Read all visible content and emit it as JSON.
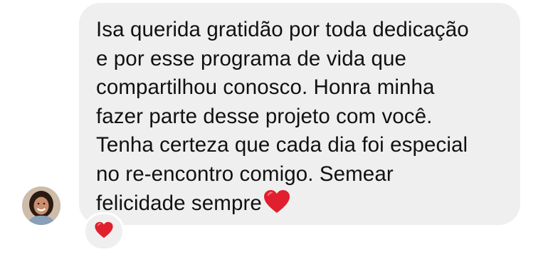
{
  "message": {
    "lines": [
      "Isa querida gratidão por toda dedicação",
      "e por esse programa de vida que",
      "compartilhou conosco. Honra minha",
      "fazer parte desse projeto com você.",
      "Tenha certeza que cada dia foi especial",
      "no  re-encontro comigo. Semear",
      "felicidade sempre"
    ],
    "trailing_icon": "red-heart-emoji"
  },
  "reaction": {
    "icon": "red-heart-emoji"
  },
  "colors": {
    "bubble": "#efeff0",
    "text": "#111111",
    "heart": "#e0202e"
  }
}
